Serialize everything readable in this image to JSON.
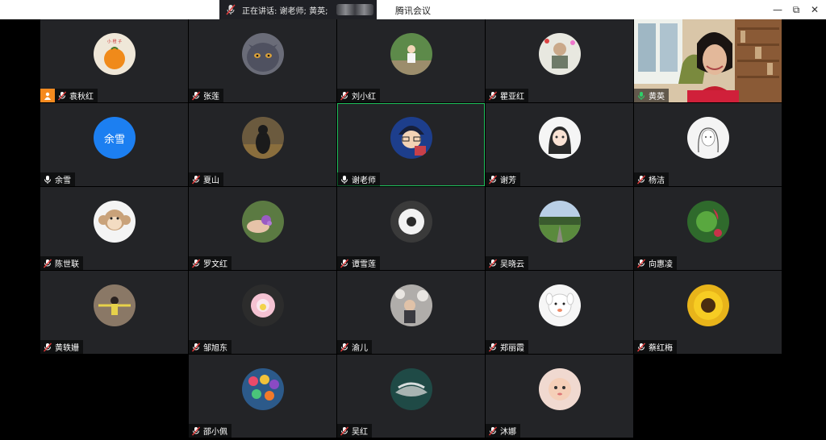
{
  "titlebar": {
    "speaking_text": "正在讲话: 谢老师; 黄英;",
    "app_title": "腾讯会议",
    "minimize": "—",
    "restore": "⧉",
    "close": "✕"
  },
  "participants": [
    {
      "name": "袁秋红",
      "mic": "host",
      "avatar": "orange-fruit"
    },
    {
      "name": "张莲",
      "mic": "muted",
      "avatar": "cat"
    },
    {
      "name": "刘小红",
      "mic": "muted",
      "avatar": "child-outdoors"
    },
    {
      "name": "瞿亚红",
      "mic": "muted",
      "avatar": "person-poster"
    },
    {
      "name": "黄英",
      "mic": "active",
      "avatar": "video-feed"
    },
    {
      "name": "余雪",
      "mic": "on",
      "avatar": "text",
      "avatar_text": "余雪"
    },
    {
      "name": "夏山",
      "mic": "muted",
      "avatar": "silhouette"
    },
    {
      "name": "谢老师",
      "mic": "on",
      "avatar": "anime-character"
    },
    {
      "name": "谢芳",
      "mic": "muted",
      "avatar": "anime-girl"
    },
    {
      "name": "杨洁",
      "mic": "muted",
      "avatar": "sketch-girl"
    },
    {
      "name": "陈世联",
      "mic": "muted",
      "avatar": "monkey"
    },
    {
      "name": "罗文红",
      "mic": "muted",
      "avatar": "hand-flower"
    },
    {
      "name": "谭雪莲",
      "mic": "muted",
      "avatar": "white-flower"
    },
    {
      "name": "吴晓云",
      "mic": "muted",
      "avatar": "road-landscape"
    },
    {
      "name": "向惠凌",
      "mic": "muted",
      "avatar": "lotus-leaf"
    },
    {
      "name": "黄轶姗",
      "mic": "muted",
      "avatar": "person-yellow"
    },
    {
      "name": "邹旭东",
      "mic": "muted",
      "avatar": "pink-flower"
    },
    {
      "name": "渝儿",
      "mic": "muted",
      "avatar": "person-blossoms"
    },
    {
      "name": "郑丽霞",
      "mic": "muted",
      "avatar": "white-dog"
    },
    {
      "name": "蔡红梅",
      "mic": "muted",
      "avatar": "sunflower"
    },
    {
      "name": "邵小佩",
      "mic": "muted",
      "avatar": "colorful-flowers"
    },
    {
      "name": "吴红",
      "mic": "muted",
      "avatar": "hands"
    },
    {
      "name": "沐娜",
      "mic": "muted",
      "avatar": "baby"
    }
  ]
}
